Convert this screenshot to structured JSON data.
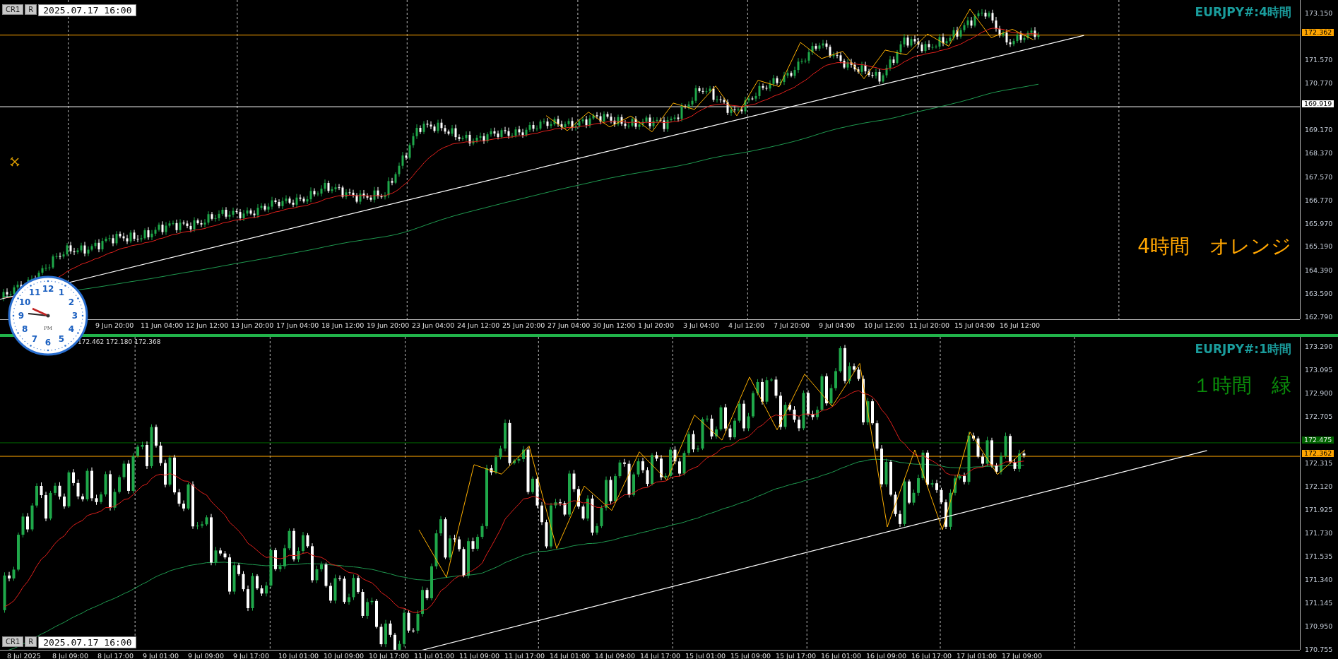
{
  "panes": [
    {
      "kind": "h4",
      "buttons": [
        "CR1",
        "R"
      ],
      "datetime": "2025.07.17 16:00",
      "symbol_label": "EURJPY#:4時間",
      "note": {
        "text": "4時間　オレンジ",
        "color": "#ffa500"
      },
      "price_ticks": [
        "173.150",
        "171.570",
        "170.770",
        "169.170",
        "168.370",
        "167.570",
        "166.770",
        "165.970",
        "165.190",
        "164.390",
        "163.590",
        "162.790"
      ],
      "price_markers": [
        {
          "value": "172.362",
          "color": "#ffa500"
        },
        {
          "value": "169.919",
          "color": "#ffffff"
        }
      ],
      "time_labels": [
        "9 Jun 20:00",
        "11 Jun 04:00",
        "12 Jun 12:00",
        "13 Jun 20:00",
        "17 Jun 04:00",
        "18 Jun 12:00",
        "19 Jun 20:00",
        "23 Jun 04:00",
        "24 Jun 12:00",
        "25 Jun 20:00",
        "27 Jun 04:00",
        "30 Jun 12:00",
        "1 Jul 20:00",
        "3 Jul 04:00",
        "4 Jul 12:00",
        "7 Jul 20:00",
        "9 Jul 04:00",
        "10 Jul 12:00",
        "11 Jul 20:00",
        "15 Jul 04:00",
        "16 Jul 12:00"
      ]
    },
    {
      "kind": "h1",
      "ohlc": "172.462 172.180 172.368",
      "buttons": [
        "CR1",
        "R"
      ],
      "datetime": "2025.07.17 16:00",
      "symbol_label": "EURJPY#:1時間",
      "note": {
        "text": "１時間　緑",
        "color": "#0a8a0a"
      },
      "price_ticks": [
        "173.290",
        "173.095",
        "172.900",
        "172.705",
        "172.315",
        "172.120",
        "171.925",
        "171.730",
        "171.535",
        "171.340",
        "171.145",
        "170.950",
        "170.755"
      ],
      "price_markers": [
        {
          "value": "172.475",
          "color": "#006400"
        },
        {
          "value": "172.362",
          "color": "#ffa500"
        }
      ],
      "time_labels": [
        "8 Jul 2025",
        "8 Jul 09:00",
        "8 Jul 17:00",
        "9 Jul 01:00",
        "9 Jul 09:00",
        "9 Jul 17:00",
        "10 Jul 01:00",
        "10 Jul 09:00",
        "10 Jul 17:00",
        "11 Jul 01:00",
        "11 Jul 09:00",
        "11 Jul 17:00",
        "14 Jul 01:00",
        "14 Jul 09:00",
        "14 Jul 17:00",
        "15 Jul 01:00",
        "15 Jul 09:00",
        "15 Jul 17:00",
        "16 Jul 01:00",
        "16 Jul 09:00",
        "16 Jul 17:00",
        "17 Jul 01:00",
        "17 Jul 09:00"
      ]
    }
  ],
  "clock": {
    "numbers": [
      "12",
      "11",
      "1",
      "10",
      "2",
      "9",
      "3",
      "8",
      "4",
      "7",
      "5",
      "6"
    ],
    "period": "PM"
  }
}
